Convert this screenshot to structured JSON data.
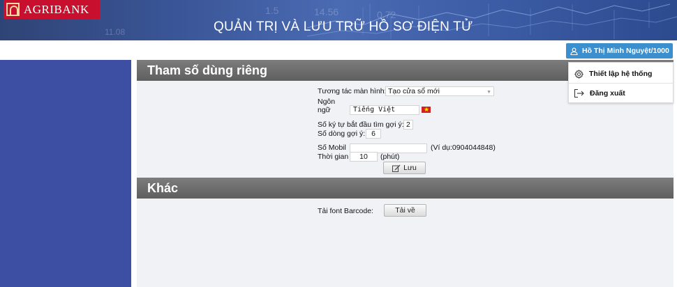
{
  "header": {
    "logo_text": "AGRIBANK",
    "title": "QUẢN TRỊ VÀ LƯU TRỮ HỒ SƠ ĐIỆN TỬ"
  },
  "user": {
    "name": "Hồ Thị Minh Nguyệt/1000",
    "menu": [
      {
        "label": "Thiết lập hệ thống",
        "icon": "gear-icon"
      },
      {
        "label": "Đăng xuất",
        "icon": "logout-icon"
      }
    ]
  },
  "section_personal": {
    "title": "Tham số dùng riêng",
    "screen_interaction_label": "Tương tác màn hình:",
    "screen_interaction_value": "Tạo cửa sổ mới",
    "language_label_line1": "Ngôn",
    "language_label_line2": "ngữ",
    "language_value": "Tiếng Việt",
    "suggest_chars_label": "Số ký tự bắt đầu tìm gợi ý:",
    "suggest_chars_value": "2",
    "suggest_rows_label": "Số dòng gợi ý:",
    "suggest_rows_value": "6",
    "mobile_label": "Số Mobil",
    "mobile_value": "",
    "mobile_hint": "(Ví dụ:0904044848)",
    "time_label": "Thời gian",
    "time_value": "10",
    "time_unit": "(phút)",
    "save_label": "Lưu"
  },
  "section_other": {
    "title": "Khác",
    "barcode_label": "Tải font Barcode:",
    "download_label": "Tải về"
  },
  "colors": {
    "sidebar": "#3c4fa3",
    "user_button": "#3b8fcf",
    "logo": "#c8102e",
    "section_bar": "#6b6b6b"
  }
}
